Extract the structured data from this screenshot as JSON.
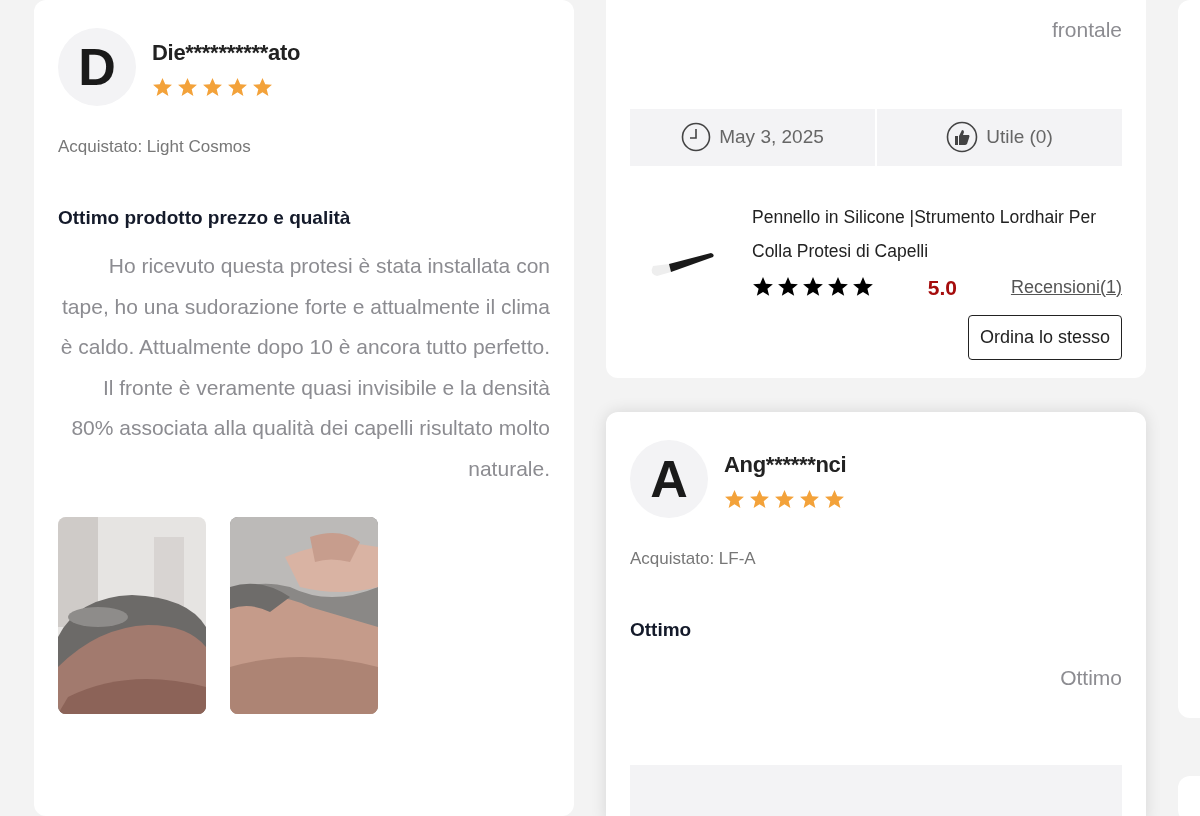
{
  "left_review": {
    "avatar_letter": "D",
    "reviewer": "Die**********ato",
    "stars": 5,
    "purchased": "Acquistato: Light Cosmos",
    "title": "Ottimo prodotto prezzo e qualità",
    "body": "Ho ricevuto questa protesi è stata installata con tape, ho una sudorazione forte e attualmente il clima è caldo. Attualmente dopo 10 è ancora tutto perfetto. Il fronte è veramente quasi invisibile e la densità 80% associata alla qualità dei capelli risultato molto naturale.",
    "photos": [
      {
        "kind": "picture"
      },
      {
        "kind": "picture"
      }
    ]
  },
  "right_top_review": {
    "body_tail": "frontale",
    "date": "May 3, 2025",
    "helpful": "Utile (0)",
    "product": {
      "name": "Pennello in Silicone |Strumento Lordhair Per Colla Protesi di Capelli",
      "stars": 5,
      "score": "5.0",
      "reviews_link": "Recensioni(1)",
      "order_button": "Ordina lo stesso"
    }
  },
  "right_bottom_review": {
    "avatar_letter": "A",
    "reviewer": "Ang******nci",
    "stars": 5,
    "purchased": "Acquistato: LF-A",
    "title": "Ottimo",
    "body": "Ottimo"
  }
}
